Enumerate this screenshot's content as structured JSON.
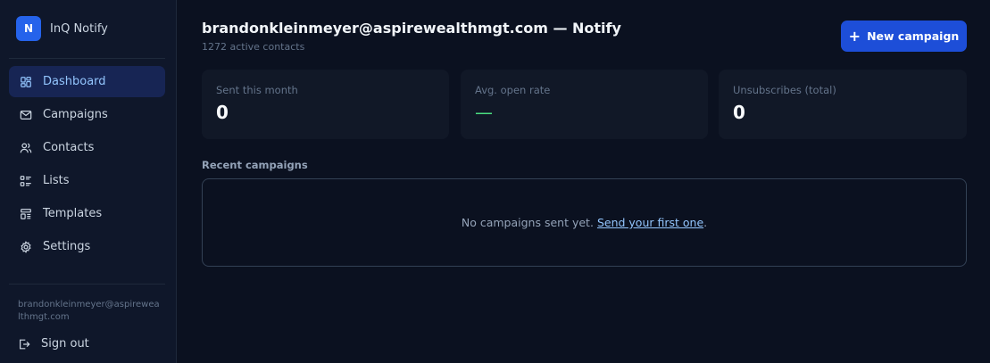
{
  "brand": {
    "logo_letter": "N",
    "name": "InQ Notify"
  },
  "sidebar": {
    "items": [
      {
        "label": "Dashboard",
        "icon": "dashboard-icon",
        "active": true
      },
      {
        "label": "Campaigns",
        "icon": "mail-icon"
      },
      {
        "label": "Contacts",
        "icon": "users-icon"
      },
      {
        "label": "Lists",
        "icon": "list-icon"
      },
      {
        "label": "Templates",
        "icon": "template-icon"
      },
      {
        "label": "Settings",
        "icon": "gear-icon"
      }
    ],
    "user_email": "brandonkleinmeyer@aspirewealthmgt.com",
    "sign_out": "Sign out"
  },
  "header": {
    "title": "brandonkleinmeyer@aspirewealthmgt.com — Notify",
    "subtitle": "1272 active contacts",
    "new_button": "New campaign"
  },
  "stats": [
    {
      "label": "Sent this month",
      "value": "0"
    },
    {
      "label": "Avg. open rate",
      "value": "—"
    },
    {
      "label": "Unsubscribes (total)",
      "value": "0"
    }
  ],
  "recent": {
    "title": "Recent campaigns",
    "empty_text": "No campaigns sent yet.",
    "empty_link": "Send your first one",
    "empty_suffix": "."
  },
  "colors": {
    "accent": "#1d4ed8",
    "active_bg": "#172554",
    "positive": "#4ade80"
  }
}
